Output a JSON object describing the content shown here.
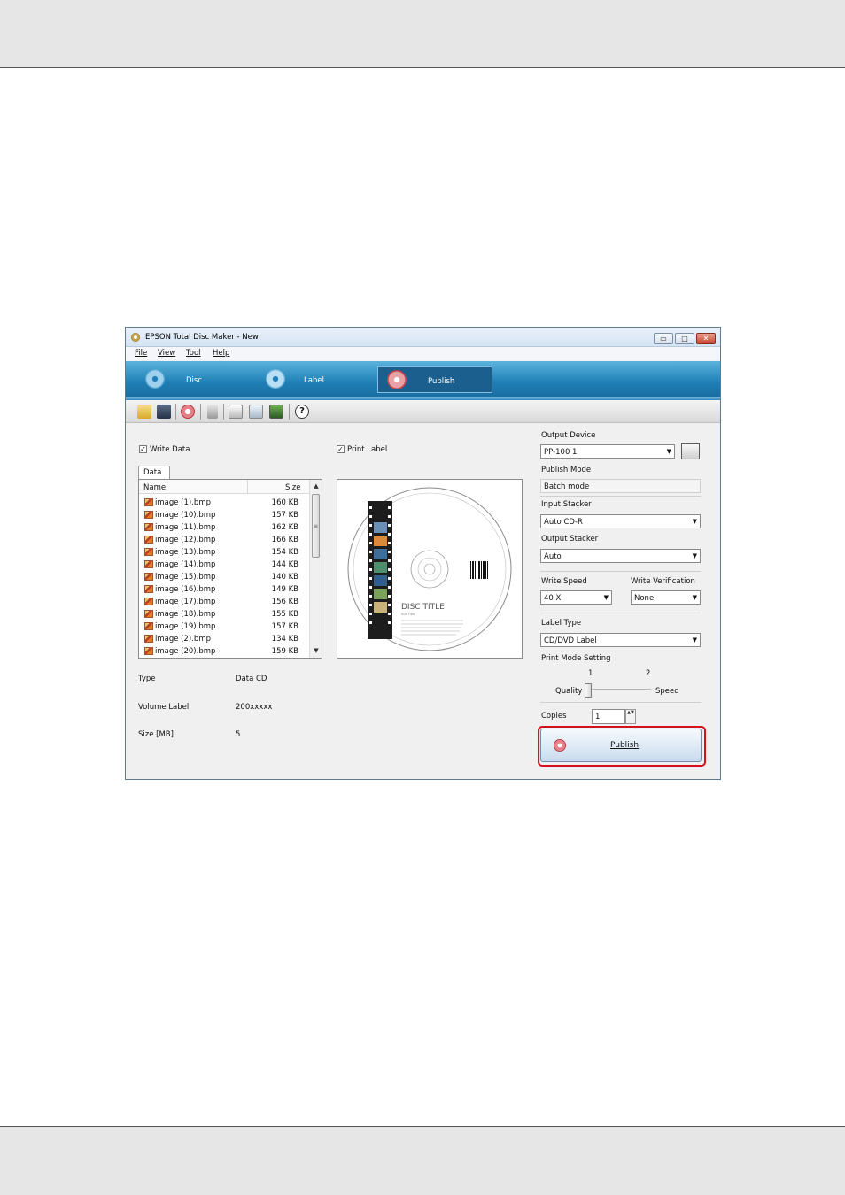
{
  "window": {
    "title": "EPSON Total Disc Maker - New",
    "controls": {
      "minimize": "▭",
      "maximize": "□",
      "close": "✕"
    }
  },
  "menu": {
    "file": "File",
    "view": "View",
    "tool": "Tool",
    "help": "Help"
  },
  "tabs": [
    {
      "label": "Disc",
      "active": false
    },
    {
      "label": "Label",
      "active": false
    },
    {
      "label": "Publish",
      "active": true
    }
  ],
  "toolbar_icons": [
    "open-folder-icon",
    "save-icon",
    "publish-disc-icon",
    "settings-wrench-icon",
    "import-icon",
    "export-icon",
    "printer-status-icon",
    "help-icon"
  ],
  "left": {
    "write_data_checked": true,
    "write_data_label": "Write Data",
    "data_tab_label": "Data",
    "columns": {
      "name": "Name",
      "size": "Size"
    },
    "files": [
      {
        "name": "image (1).bmp",
        "size": "160 KB"
      },
      {
        "name": "image (10).bmp",
        "size": "157 KB"
      },
      {
        "name": "image (11).bmp",
        "size": "162 KB"
      },
      {
        "name": "image (12).bmp",
        "size": "166 KB"
      },
      {
        "name": "image (13).bmp",
        "size": "154 KB"
      },
      {
        "name": "image (14).bmp",
        "size": "144 KB"
      },
      {
        "name": "image (15).bmp",
        "size": "140 KB"
      },
      {
        "name": "image (16).bmp",
        "size": "149 KB"
      },
      {
        "name": "image (17).bmp",
        "size": "156 KB"
      },
      {
        "name": "image (18).bmp",
        "size": "155 KB"
      },
      {
        "name": "image (19).bmp",
        "size": "157 KB"
      },
      {
        "name": "image (2).bmp",
        "size": "134 KB"
      },
      {
        "name": "image (20).bmp",
        "size": "159 KB"
      }
    ],
    "scroll": {
      "up": "▲",
      "down": "▼",
      "grip": "≡"
    },
    "info": {
      "type_label": "Type",
      "type_value": "Data CD",
      "volume_label": "Volume Label",
      "volume_value": "200xxxxx",
      "size_label": "Size [MB]",
      "size_value": "5"
    }
  },
  "middle": {
    "print_label_checked": true,
    "print_label_label": "Print Label",
    "disc_title": "DISC TITLE",
    "disc_subtitle": "Sub Title"
  },
  "right": {
    "output_device_label": "Output Device",
    "output_device_value": "PP-100 1",
    "publish_mode_label": "Publish Mode",
    "publish_mode_value": "Batch mode",
    "input_stacker_label": "Input Stacker",
    "input_stacker_value": "Auto  CD-R",
    "output_stacker_label": "Output Stacker",
    "output_stacker_value": "Auto",
    "write_speed_label": "Write Speed",
    "write_speed_value": "40 X",
    "write_verification_label": "Write Verification",
    "write_verification_value": "None",
    "label_type_label": "Label Type",
    "label_type_value": "CD/DVD Label",
    "print_mode_label": "Print Mode Setting",
    "print_mode_tick1": "1",
    "print_mode_tick2": "2",
    "print_mode_quality": "Quality",
    "print_mode_speed": "Speed",
    "print_mode_level": 1,
    "copies_label": "Copies",
    "copies_value": "1",
    "publish_button": "Publish",
    "dropdown_glyph": "▼",
    "spin_glyph": "▲▼"
  },
  "colors": {
    "banner": "#1f7fb6",
    "highlight_frame": "#d4121c"
  }
}
